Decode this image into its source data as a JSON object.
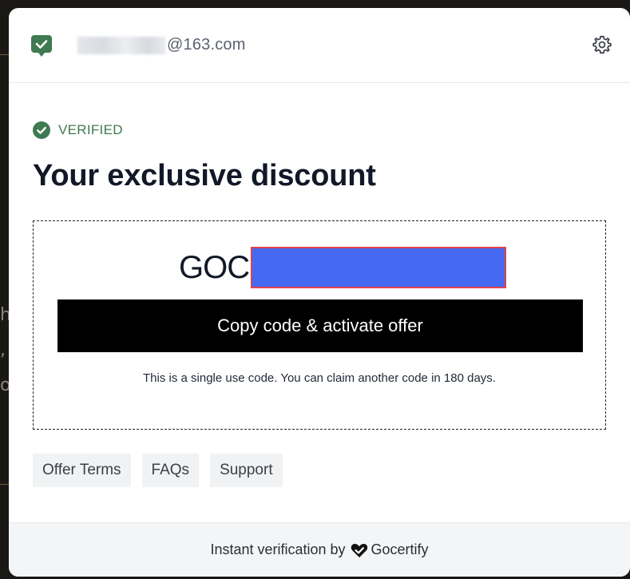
{
  "header": {
    "email_domain": "@163.com",
    "mail_icon": "verified-mail-icon",
    "settings_icon": "gear-icon"
  },
  "status": {
    "label": "VERIFIED",
    "icon": "check-circle-icon",
    "color": "#3f7a52"
  },
  "title": "Your exclusive discount",
  "code": {
    "prefix": "GOC",
    "redaction_color": "#4569f0",
    "redaction_border": "#e0424a"
  },
  "copy_button": "Copy code & activate offer",
  "note": "This is a single use code. You can claim another code in 180 days.",
  "links": [
    "Offer Terms",
    "FAQs",
    "Support"
  ],
  "footer": {
    "text": "Instant verification by",
    "brand": "Gocertify"
  }
}
